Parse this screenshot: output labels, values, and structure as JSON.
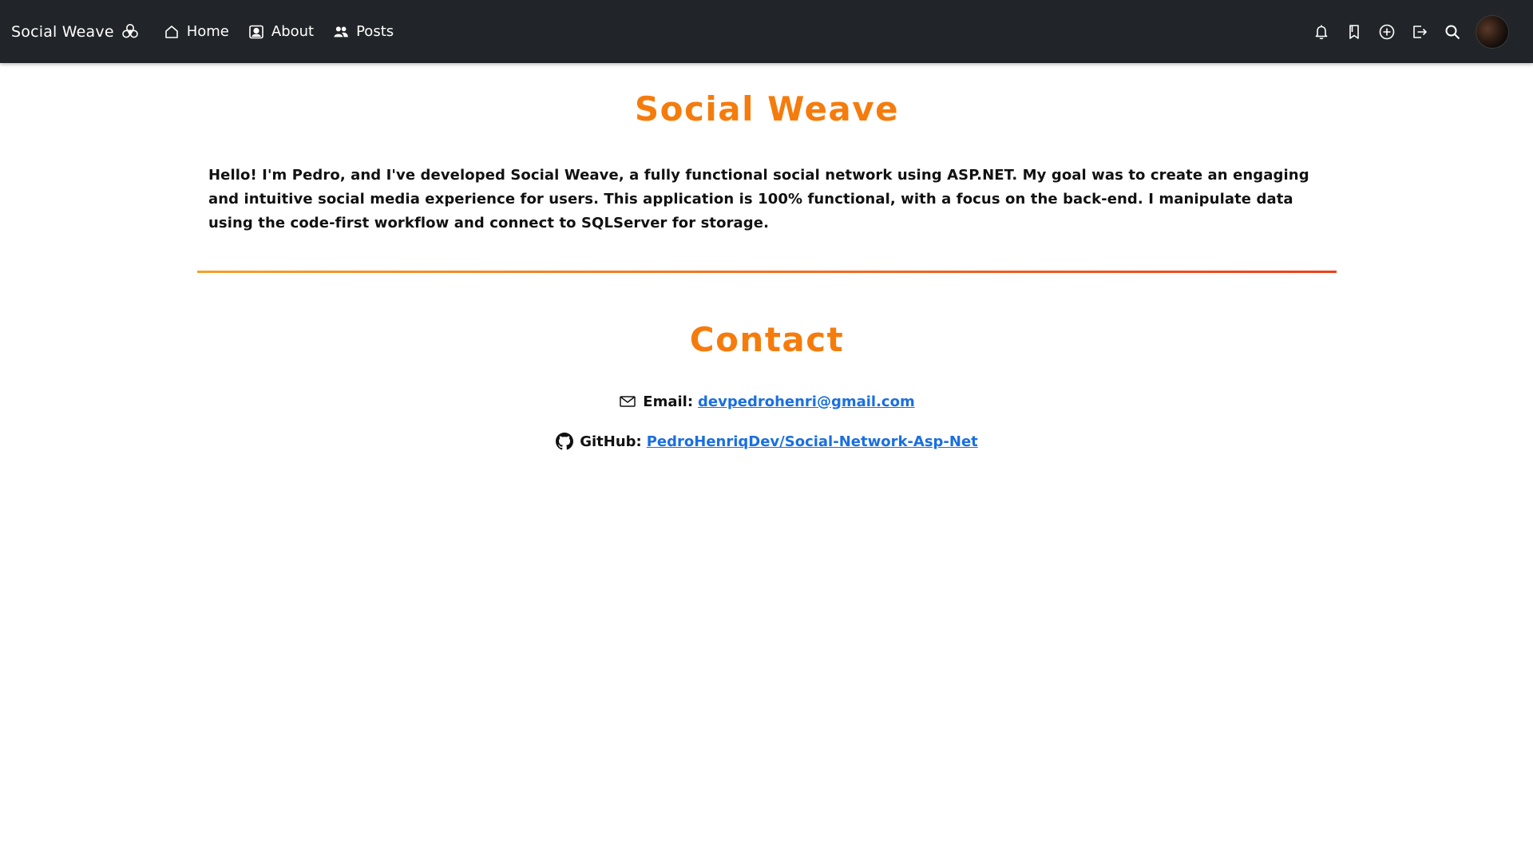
{
  "navbar": {
    "brand": "Social Weave",
    "links": [
      {
        "label": "Home",
        "icon": "house-icon"
      },
      {
        "label": "About",
        "icon": "person-badge-icon"
      },
      {
        "label": "Posts",
        "icon": "people-icon"
      }
    ],
    "right_icons": [
      "bell-icon",
      "bookmark-icon",
      "plus-circle-icon",
      "sign-out-icon",
      "search-icon"
    ],
    "avatar": "user-avatar"
  },
  "main": {
    "title": "Social Weave",
    "intro": "Hello! I'm Pedro, and I've developed Social Weave, a fully functional social network using ASP.NET. My goal was to create an engaging and intuitive social media experience for users. This application is 100% functional, with a focus on the back-end. I manipulate data using the code-first workflow and connect to SQLServer for storage.",
    "contact": {
      "title": "Contact",
      "email_label": "Email:",
      "email_value": "devpedrohenri@gmail.com",
      "github_label": "GitHub:",
      "github_value": "PedroHenriqDev/Social-Network-Asp-Net"
    }
  },
  "colors": {
    "navbar_bg": "#212529",
    "accent_orange": "#f57c0c",
    "link_blue": "#1a6fe0",
    "divider_gradient": [
      "#f5a02a",
      "#ee3f1a"
    ]
  }
}
